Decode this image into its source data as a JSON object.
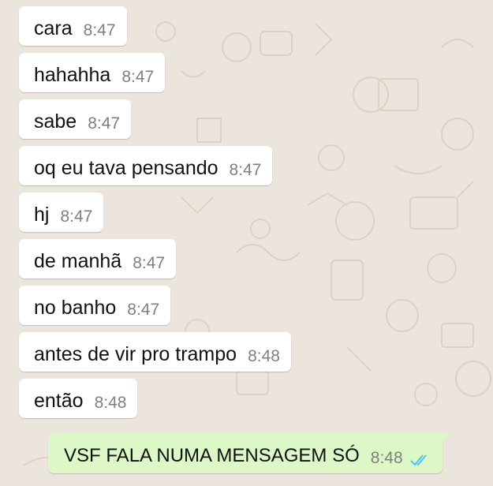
{
  "messages": [
    {
      "text": "cara",
      "time": "8:47",
      "direction": "incoming"
    },
    {
      "text": "hahahha",
      "time": "8:47",
      "direction": "incoming"
    },
    {
      "text": "sabe",
      "time": "8:47",
      "direction": "incoming"
    },
    {
      "text": "oq eu tava pensando",
      "time": "8:47",
      "direction": "incoming"
    },
    {
      "text": "hj",
      "time": "8:47",
      "direction": "incoming"
    },
    {
      "text": "de manhã",
      "time": "8:47",
      "direction": "incoming"
    },
    {
      "text": "no banho",
      "time": "8:47",
      "direction": "incoming"
    },
    {
      "text": "antes de vir pro trampo",
      "time": "8:48",
      "direction": "incoming"
    },
    {
      "text": "então",
      "time": "8:48",
      "direction": "incoming"
    },
    {
      "text": "VSF FALA NUMA MENSAGEM SÓ",
      "time": "8:48",
      "direction": "outgoing",
      "status_icon": "double-check-read-icon"
    }
  ],
  "colors": {
    "wallpaper": "#ece5dd",
    "incoming_bubble": "#ffffff",
    "outgoing_bubble": "#dcf8c6",
    "read_ticks": "#4fc3f7",
    "timestamp": "#7f7f7f"
  }
}
